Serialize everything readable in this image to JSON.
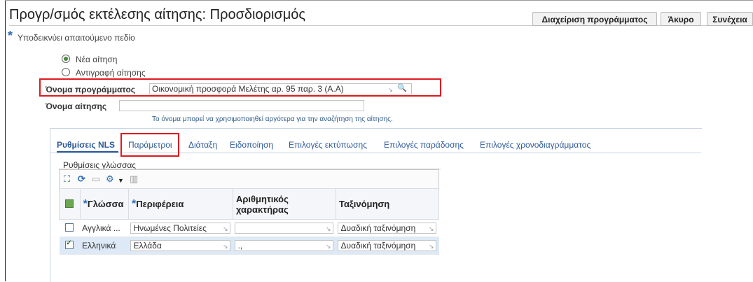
{
  "page": {
    "title": "Προγρ/σμός εκτέλεσης αίτησης: Προσδιορισμός",
    "required_note": "Υποδεικνύει απαιτούμενο πεδίο"
  },
  "buttons": {
    "manage": "Διαχείριση προγράμματος",
    "cancel": "Άκυρο",
    "continue": "Συνέχεια"
  },
  "request_type": {
    "options": [
      "Νέα αίτηση",
      "Αντιγραφή αίτησης"
    ],
    "selected": "Νέα αίτηση"
  },
  "program": {
    "label": "Όνομα προγράμματος",
    "value": "Οικονομική προσφορά Μελέτης αρ. 95 παρ. 3 (Α.Α)"
  },
  "request_name": {
    "label": "Όνομα αίτησης",
    "value": "",
    "hint": "Το όνομα μπορεί να χρησιμοποιηθεί αργότερα για την αναζήτηση της αίτησης."
  },
  "tabs": [
    {
      "label": "Ρυθμίσεις NLS",
      "active": true
    },
    {
      "label": "Παράμετροι",
      "active": false
    },
    {
      "label": "Διάταξη",
      "active": false
    },
    {
      "label": "Ειδοποίηση",
      "active": false
    },
    {
      "label": "Επιλογές εκτύπωσης",
      "active": false
    },
    {
      "label": "Επιλογές παράδοσης",
      "active": false
    },
    {
      "label": "Επιλογές χρονοδιαγράμματος",
      "active": false
    }
  ],
  "language_section": {
    "title": "Ρυθμίσεις γλώσσας",
    "columns": [
      "Γλώσσα",
      "Περιφέρεια",
      "Αριθμητικός χαρακτήρας",
      "Ταξινόμηση"
    ],
    "rows": [
      {
        "selected": false,
        "language": "Αγγλικά ...",
        "territory": "Ηνωμένες Πολιτείες",
        "numeric": "",
        "sort": "Δυαδική ταξινόμηση"
      },
      {
        "selected": true,
        "language": "Ελληνικά",
        "territory": "Ελλάδα",
        "numeric": ".,",
        "sort": "Δυαδική ταξινόμηση"
      }
    ]
  },
  "icons": [
    "detach-icon",
    "refresh-icon",
    "export-icon",
    "gear-icon",
    "dropdown-caret-icon",
    "freeze-columns-icon",
    "lov-icon",
    "search-icon"
  ],
  "colors": {
    "accent": "#2d5a9a",
    "highlight": "#e0191f",
    "selected_row": "#dde9f6"
  }
}
